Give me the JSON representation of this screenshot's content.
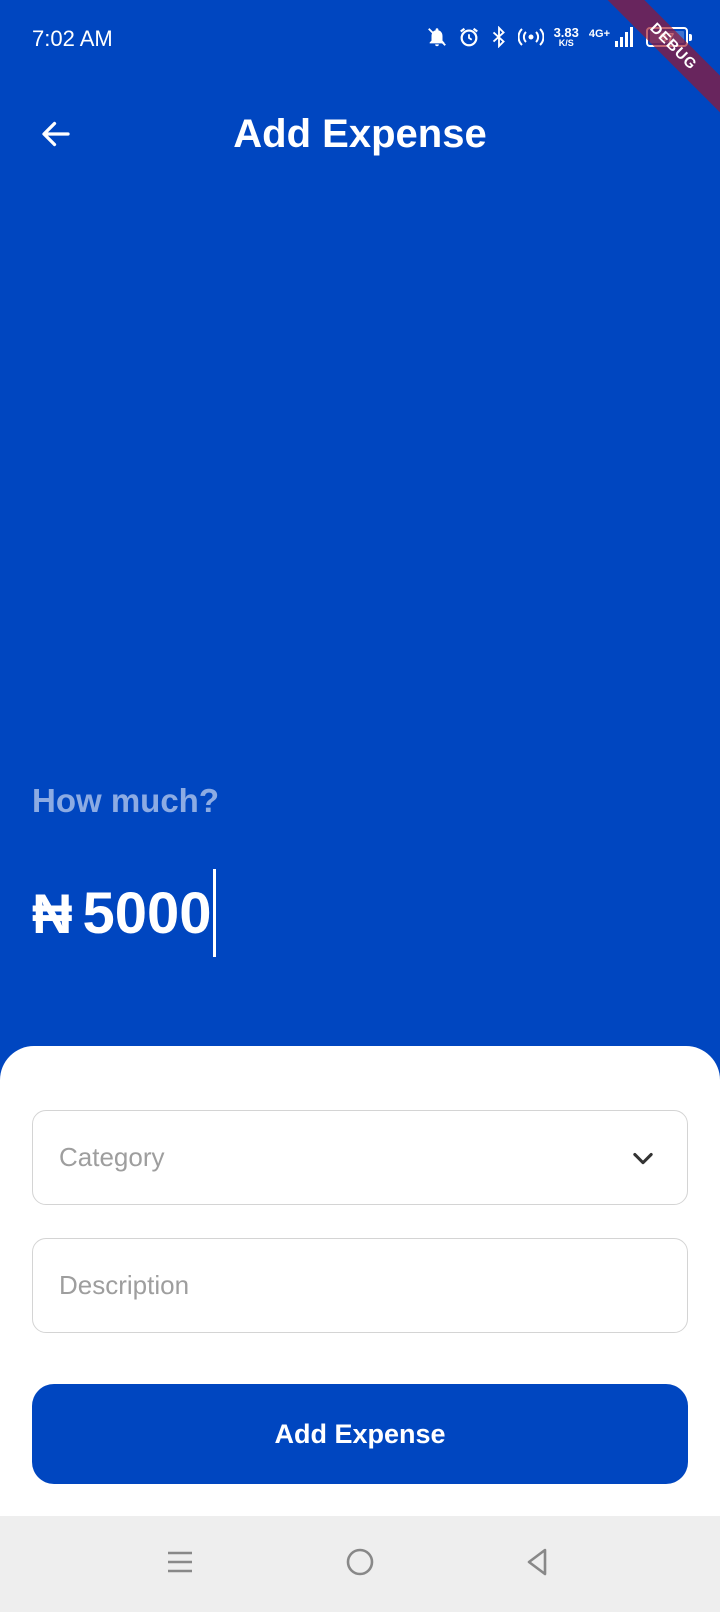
{
  "status_bar": {
    "time": "7:02 AM",
    "net_speed_value": "3.83",
    "net_speed_unit": "K/S",
    "network_type": "4G+",
    "battery_level": "97",
    "icons": [
      "bell-off-icon",
      "alarm-icon",
      "bluetooth-icon",
      "hotspot-icon",
      "signal-icon",
      "battery-icon"
    ]
  },
  "debug_banner": "DEBUG",
  "header": {
    "title": "Add Expense",
    "back_icon": "arrow-left-icon"
  },
  "amount": {
    "label": "How much?",
    "currency_symbol": "₦",
    "value": "5000"
  },
  "form": {
    "category": {
      "placeholder": "Category",
      "icon": "chevron-down-icon"
    },
    "description": {
      "placeholder": "Description",
      "value": ""
    },
    "submit_label": "Add Expense"
  },
  "nav_bar": {
    "items": [
      "menu-icon",
      "home-icon",
      "back-icon"
    ]
  },
  "colors": {
    "primary": "#0046c0",
    "sheet": "#ffffff",
    "placeholder": "#9e9e9e",
    "nav_bar": "#eeeeee"
  }
}
